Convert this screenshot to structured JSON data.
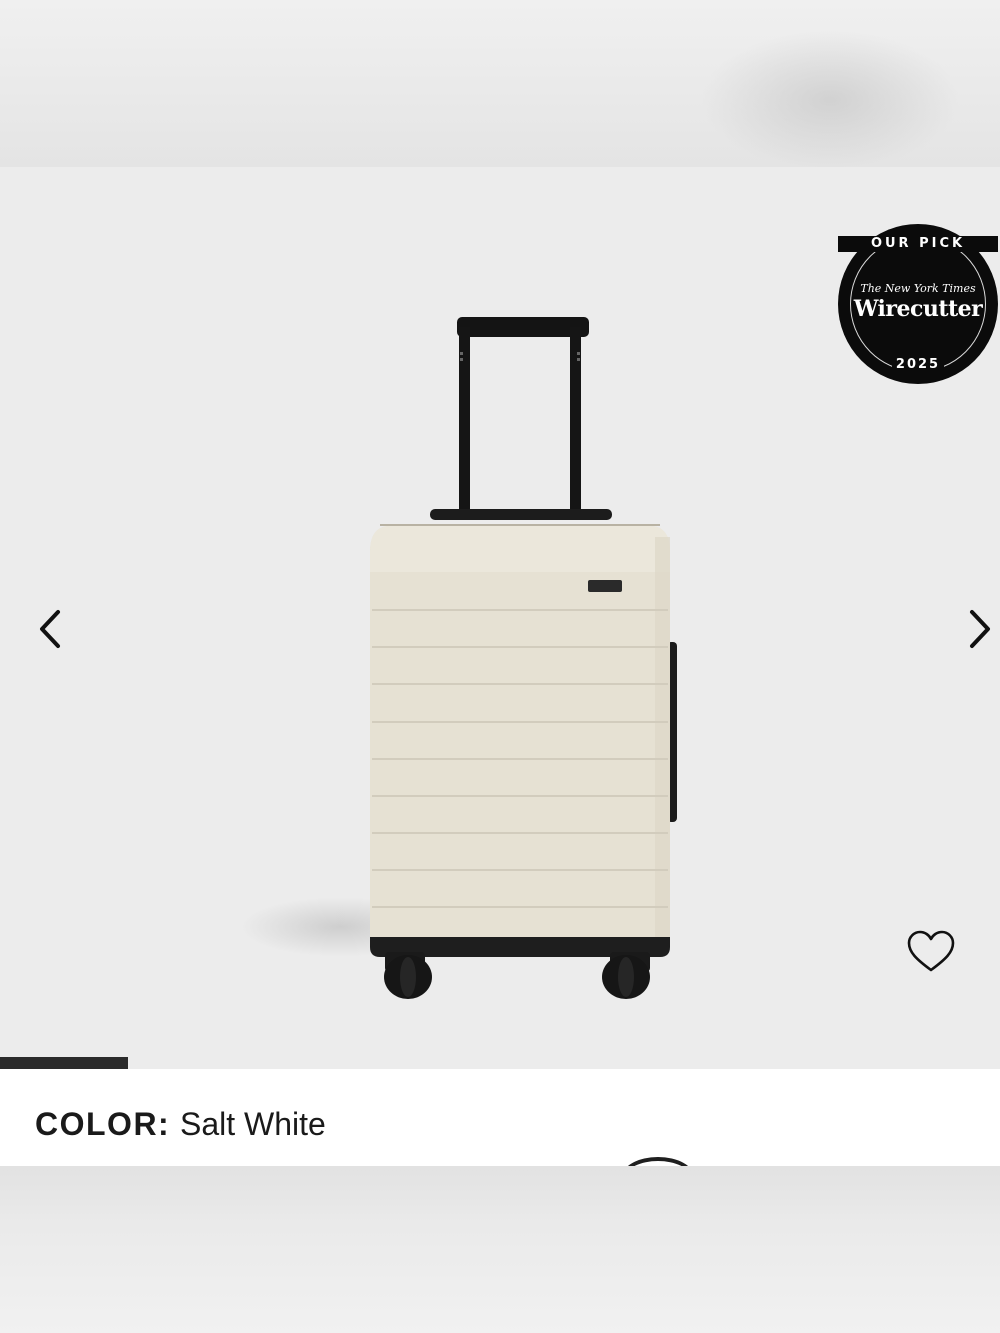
{
  "gallery": {
    "prev_icon": "chevron-left-icon",
    "next_icon": "chevron-right-icon",
    "wishlist_icon": "heart-outline-icon",
    "slide_progress": 0.128,
    "badge": {
      "top_text": "OUR PICK",
      "publisher": "The New York Times",
      "brand": "Wirecutter",
      "year": "2025"
    }
  },
  "product": {
    "color_label": "COLOR:",
    "color_value": "Salt White"
  },
  "colors": {
    "accent": "#1a1a1a",
    "suitcase_shell": "#e8e3d6",
    "background": "#ececec"
  }
}
